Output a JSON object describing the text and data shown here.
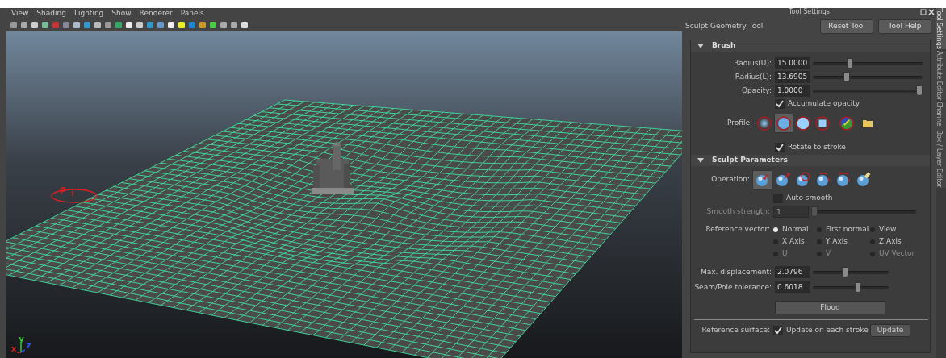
{
  "menu": [
    "View",
    "Shading",
    "Lighting",
    "Show",
    "Renderer",
    "Panels"
  ],
  "viewport": {
    "axis_labels": [
      "x",
      "y",
      "z"
    ]
  },
  "tool_settings": {
    "title": "Tool Settings",
    "tool_name": "Sculpt Geometry Tool",
    "buttons": [
      "Reset Tool",
      "Tool Help"
    ],
    "side_tabs": [
      {
        "label": "Tool Settings",
        "selected": true
      },
      {
        "label": "Attribute Editor",
        "selected": false
      },
      {
        "label": "Channel Box / Layer Editor",
        "selected": false
      }
    ],
    "brush": {
      "title": "Brush",
      "expanded": true,
      "fields": [
        {
          "label": "Radius(U):",
          "value": "15.0000",
          "level": 0.33
        },
        {
          "label": "Radius(L):",
          "value": "13.6905",
          "level": 0.3
        },
        {
          "label": "Opacity:",
          "value": "1.0000",
          "level": 1
        }
      ],
      "accumulate": {
        "label": "Accumulate opacity",
        "checked": true
      },
      "profile": {
        "label": "Profile:",
        "options": [
          {
            "kind": "soft",
            "selected": false
          },
          {
            "kind": "medium",
            "selected": true
          },
          {
            "kind": "hard",
            "selected": false
          },
          {
            "kind": "square",
            "selected": false
          },
          {
            "kind": "image",
            "selected": false
          }
        ]
      },
      "rotate": {
        "label": "Rotate to stroke",
        "checked": true
      }
    },
    "sculpt": {
      "title": "Sculpt Parameters",
      "expanded": true,
      "operation_label": "Operation:",
      "operations": [
        {
          "kind": "push",
          "selected": true
        },
        {
          "kind": "pull",
          "selected": false
        },
        {
          "kind": "smooth",
          "selected": false
        },
        {
          "kind": "relax",
          "selected": false
        },
        {
          "kind": "pinch",
          "selected": false
        },
        {
          "kind": "erase",
          "selected": false
        }
      ],
      "auto_smooth": {
        "label": "Auto smooth",
        "checked": false
      },
      "smooth_strength": {
        "label": "Smooth strength:",
        "value": "1",
        "level": 0,
        "disabled": true
      },
      "reference_vector": {
        "label": "Reference vector:",
        "options": [
          {
            "label": "Normal",
            "selected": true,
            "disabled": false
          },
          {
            "label": "First normal",
            "selected": false,
            "disabled": false
          },
          {
            "label": "View",
            "selected": false,
            "disabled": false
          },
          {
            "label": "X Axis",
            "selected": false,
            "disabled": false
          },
          {
            "label": "Y Axis",
            "selected": false,
            "disabled": false
          },
          {
            "label": "Z Axis",
            "selected": false,
            "disabled": false
          },
          {
            "label": "U",
            "selected": false,
            "disabled": true
          },
          {
            "label": "V",
            "selected": false,
            "disabled": true
          },
          {
            "label": "UV Vector",
            "selected": false,
            "disabled": true
          }
        ]
      },
      "fields": [
        {
          "label": "Max. displacement:",
          "value": "2.0796",
          "level": 0.42
        },
        {
          "label": "Seam/Pole tolerance:",
          "value": "0.6018",
          "level": 0.6
        }
      ],
      "flood": "Flood",
      "reference_surface": {
        "label": "Reference surface:",
        "checkbox": "Update on each stroke",
        "checked": true,
        "button": "Update"
      }
    }
  }
}
